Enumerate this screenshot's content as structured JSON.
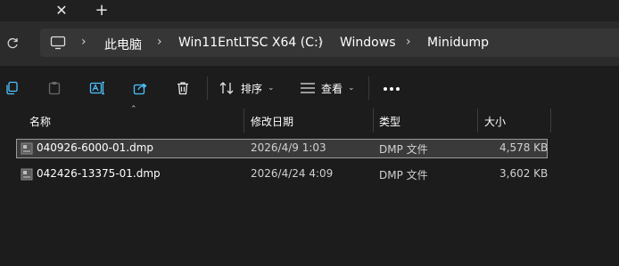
{
  "tabs": {
    "close_glyph": "✕",
    "new_tab_glyph": "+"
  },
  "breadcrumb": {
    "items": [
      {
        "label": "此电脑"
      },
      {
        "label": "Win11EntLTSC X64 (C:)"
      },
      {
        "label": "Windows"
      },
      {
        "label": "Minidump"
      }
    ]
  },
  "toolbar": {
    "sort_label": "排序",
    "view_label": "查看"
  },
  "columns": {
    "name": "名称",
    "modified": "修改日期",
    "type": "类型",
    "size": "大小"
  },
  "files": [
    {
      "name": "040926-6000-01.dmp",
      "modified": "2026/4/9 1:03",
      "type": "DMP 文件",
      "size": "4,578 KB",
      "selected": true
    },
    {
      "name": "042426-13375-01.dmp",
      "modified": "2026/4/24 4:09",
      "type": "DMP 文件",
      "size": "3,602 KB",
      "selected": false
    }
  ],
  "colors": {
    "accent": "#4cc2ff",
    "window_bg": "#1c1c1c",
    "address_bg": "#2b2b2b"
  }
}
